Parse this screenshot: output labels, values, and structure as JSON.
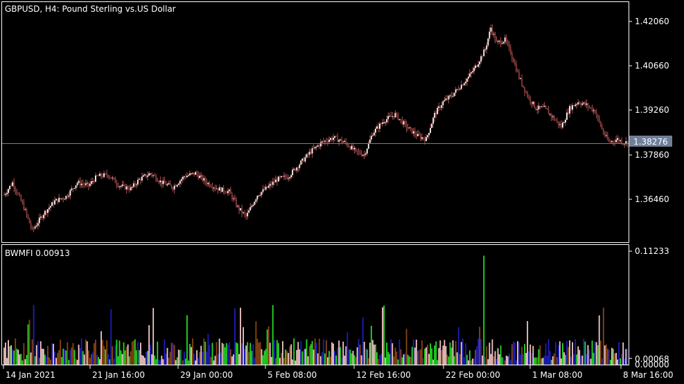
{
  "main_panel": {
    "title": "GBPUSD, H4:  Pound Sterling vs.US Dollar",
    "price_ticks": [
      "1.42060",
      "1.40660",
      "1.39260",
      "1.37860",
      "1.36460"
    ],
    "current_price": "1.38276"
  },
  "indicator_panel": {
    "title": "BWMFI 0.00913",
    "ticks": [
      "0.11233",
      "0.00068",
      "0.00000"
    ]
  },
  "time_axis": {
    "labels": [
      "14 Jan 2021",
      "21 Jan 16:00",
      "29 Jan 00:00",
      "5 Feb 08:00",
      "12 Feb 16:00",
      "22 Feb 00:00",
      "1 Mar 08:00",
      "8 Mar 16:00"
    ]
  },
  "colors": {
    "background": "#000000",
    "frame": "#ffffff",
    "bull_candle": "#ffffff",
    "bear_candle": "#8b3a3a",
    "wick": "#b05050",
    "price_line": "#6e7f98",
    "price_badge": "#6e7f98",
    "mfi_green": "#22dd22",
    "mfi_blue": "#1e1ebe",
    "mfi_pink": "#f4c8c8",
    "mfi_brown": "#8b4513"
  },
  "chart_data": {
    "type": "candlestick",
    "symbol": "GBPUSD",
    "timeframe": "H4",
    "ylim": [
      1.351,
      1.428
    ],
    "close_path": [
      [
        0,
        1.366
      ],
      [
        6,
        1.37
      ],
      [
        14,
        1.362
      ],
      [
        20,
        1.3545
      ],
      [
        28,
        1.36
      ],
      [
        36,
        1.364
      ],
      [
        44,
        1.3655
      ],
      [
        52,
        1.37
      ],
      [
        60,
        1.369
      ],
      [
        66,
        1.372
      ],
      [
        74,
        1.3725
      ],
      [
        82,
        1.369
      ],
      [
        90,
        1.368
      ],
      [
        96,
        1.371
      ],
      [
        104,
        1.373
      ],
      [
        112,
        1.37
      ],
      [
        120,
        1.3685
      ],
      [
        128,
        1.372
      ],
      [
        136,
        1.373
      ],
      [
        144,
        1.37
      ],
      [
        152,
        1.368
      ],
      [
        160,
        1.367
      ],
      [
        166,
        1.362
      ],
      [
        172,
        1.359
      ],
      [
        180,
        1.366
      ],
      [
        186,
        1.368
      ],
      [
        194,
        1.371
      ],
      [
        202,
        1.372
      ],
      [
        210,
        1.376
      ],
      [
        218,
        1.38
      ],
      [
        226,
        1.383
      ],
      [
        234,
        1.3845
      ],
      [
        242,
        1.383
      ],
      [
        250,
        1.38
      ],
      [
        256,
        1.379
      ],
      [
        262,
        1.386
      ],
      [
        270,
        1.39
      ],
      [
        278,
        1.392
      ],
      [
        286,
        1.388
      ],
      [
        294,
        1.385
      ],
      [
        300,
        1.384
      ],
      [
        306,
        1.392
      ],
      [
        312,
        1.396
      ],
      [
        318,
        1.398
      ],
      [
        324,
        1.401
      ],
      [
        330,
        1.404
      ],
      [
        336,
        1.408
      ],
      [
        342,
        1.413
      ],
      [
        346,
        1.42
      ],
      [
        350,
        1.415
      ],
      [
        356,
        1.416
      ],
      [
        360,
        1.412
      ],
      [
        366,
        1.404
      ],
      [
        372,
        1.398
      ],
      [
        378,
        1.394
      ],
      [
        384,
        1.394
      ],
      [
        390,
        1.391
      ],
      [
        396,
        1.388
      ],
      [
        402,
        1.394
      ],
      [
        408,
        1.396
      ],
      [
        414,
        1.395
      ],
      [
        420,
        1.393
      ],
      [
        426,
        1.386
      ],
      [
        430,
        1.383
      ],
      [
        436,
        1.384
      ],
      [
        440,
        1.383
      ],
      [
        443,
        1.383
      ]
    ],
    "indicator": {
      "name": "BWMFI",
      "value": 0.00913,
      "ylim": [
        0,
        0.11233
      ],
      "bar_colors": [
        "green",
        "blue",
        "pink",
        "brown"
      ]
    }
  }
}
